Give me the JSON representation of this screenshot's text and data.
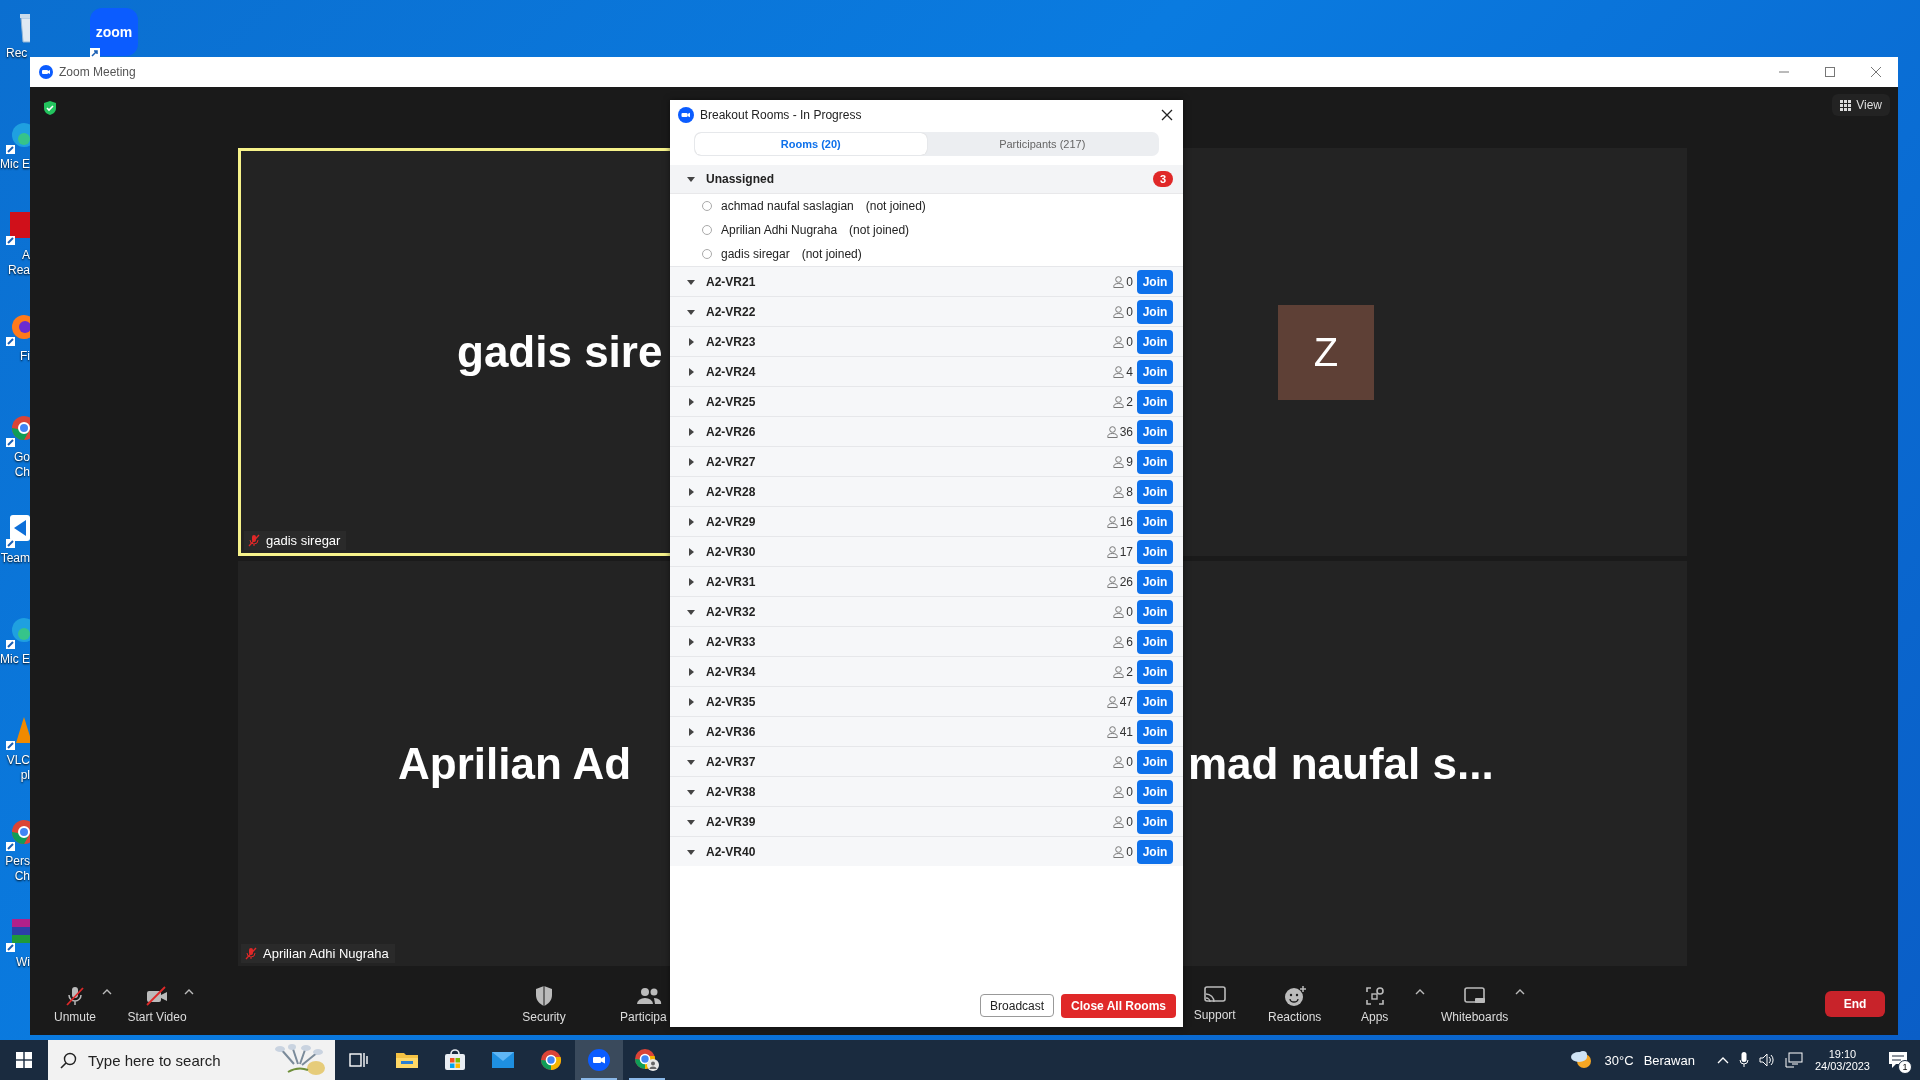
{
  "desktop": {
    "icons": [
      {
        "kind": "recycle",
        "label": "Rec"
      },
      {
        "kind": "edge",
        "label": "Mic E"
      },
      {
        "kind": "pdf",
        "label": "A Rea"
      },
      {
        "kind": "firefox",
        "label": "Fi"
      },
      {
        "kind": "chrome",
        "label": "Go Ch"
      },
      {
        "kind": "teamviewer",
        "label": "Team"
      },
      {
        "kind": "edge",
        "label": "Mic E"
      },
      {
        "kind": "vlc",
        "label": "VLC pl"
      },
      {
        "kind": "chrome",
        "label": "Pers Ch"
      },
      {
        "kind": "winrar",
        "label": "Wi"
      }
    ],
    "zoom_shortcut": {
      "label": "zoom"
    }
  },
  "window": {
    "title": "Zoom Meeting",
    "view_button": "View"
  },
  "videos": [
    {
      "kind": "name",
      "big_name": "gadis sire",
      "name_tag": "gadis siregar",
      "muted": true,
      "speaking": true
    },
    {
      "kind": "avatar",
      "avatar": "Z",
      "speaking": false
    },
    {
      "kind": "name",
      "big_name": "Aprilian Ad",
      "name_tag": "Aprilian Adhi Nugraha",
      "muted": true,
      "speaking": false
    },
    {
      "kind": "name",
      "big_name": "mad naufal s...",
      "speaking": false
    }
  ],
  "dialog": {
    "title": "Breakout Rooms - In Progress",
    "tabs": [
      {
        "label": "Rooms (20)",
        "selected": true
      },
      {
        "label": "Participants (217)",
        "selected": false
      }
    ],
    "unassigned": {
      "label": "Unassigned",
      "expanded": true,
      "count": "3",
      "participants": [
        {
          "name": "achmad naufal saslagian",
          "status": "(not joined)",
          "selected": false
        },
        {
          "name": "Aprilian Adhi Nugraha",
          "status": "(not joined)",
          "selected": false
        },
        {
          "name": "gadis siregar",
          "status": "(not joined)",
          "selected": false
        }
      ]
    },
    "rooms": [
      {
        "name": "A2-VR21",
        "expanded": true,
        "count": "0",
        "button": "Join"
      },
      {
        "name": "A2-VR22",
        "expanded": true,
        "count": "0",
        "button": "Join"
      },
      {
        "name": "A2-VR23",
        "expanded": false,
        "count": "0",
        "button": "Join"
      },
      {
        "name": "A2-VR24",
        "expanded": false,
        "count": "4",
        "button": "Join"
      },
      {
        "name": "A2-VR25",
        "expanded": false,
        "count": "2",
        "button": "Join"
      },
      {
        "name": "A2-VR26",
        "expanded": false,
        "count": "36",
        "button": "Join"
      },
      {
        "name": "A2-VR27",
        "expanded": false,
        "count": "9",
        "button": "Join"
      },
      {
        "name": "A2-VR28",
        "expanded": false,
        "count": "8",
        "button": "Join"
      },
      {
        "name": "A2-VR29",
        "expanded": false,
        "count": "16",
        "button": "Join"
      },
      {
        "name": "A2-VR30",
        "expanded": false,
        "count": "17",
        "button": "Join"
      },
      {
        "name": "A2-VR31",
        "expanded": false,
        "count": "26",
        "button": "Join"
      },
      {
        "name": "A2-VR32",
        "expanded": true,
        "count": "0",
        "button": "Join"
      },
      {
        "name": "A2-VR33",
        "expanded": false,
        "count": "6",
        "button": "Join"
      },
      {
        "name": "A2-VR34",
        "expanded": false,
        "count": "2",
        "button": "Join"
      },
      {
        "name": "A2-VR35",
        "expanded": false,
        "count": "47",
        "button": "Join"
      },
      {
        "name": "A2-VR36",
        "expanded": false,
        "count": "41",
        "button": "Join"
      },
      {
        "name": "A2-VR37",
        "expanded": true,
        "count": "0",
        "button": "Join"
      },
      {
        "name": "A2-VR38",
        "expanded": true,
        "count": "0",
        "button": "Join"
      },
      {
        "name": "A2-VR39",
        "expanded": true,
        "count": "0",
        "button": "Join"
      },
      {
        "name": "A2-VR40",
        "expanded": true,
        "count": "0",
        "button": "Join"
      }
    ],
    "buttons": [
      {
        "label": "Broadcast",
        "kind": "secondary"
      },
      {
        "label": "Close All Rooms",
        "kind": "danger"
      }
    ]
  },
  "toolbar": {
    "left": [
      {
        "kind": "mic-off",
        "label": "Unmute",
        "caret": true
      },
      {
        "kind": "video-off",
        "label": "Start Video",
        "caret": true
      }
    ],
    "middle": [
      {
        "kind": "shield",
        "label": "Security",
        "caret": false
      },
      {
        "kind": "people",
        "label": "Participa",
        "caret": false
      }
    ],
    "right": [
      {
        "kind": "cast",
        "label": "Support",
        "caret": false
      },
      {
        "kind": "smile",
        "label": "Reactions",
        "caret": false
      },
      {
        "kind": "apps",
        "label": "Apps",
        "caret": true
      },
      {
        "kind": "whiteboard",
        "label": "Whiteboards",
        "caret": true
      }
    ],
    "end": "End"
  },
  "taskbar": {
    "search": {
      "placeholder": "Type here to search"
    },
    "apps": [
      {
        "kind": "taskview",
        "selected": false,
        "running": false
      },
      {
        "kind": "folder",
        "selected": false,
        "running": false
      },
      {
        "kind": "store",
        "selected": false,
        "running": false
      },
      {
        "kind": "mail",
        "selected": false,
        "running": false
      },
      {
        "kind": "chrome",
        "selected": false,
        "running": false
      },
      {
        "kind": "zoom",
        "selected": true,
        "running": true
      },
      {
        "kind": "chrome-profile",
        "selected": false,
        "running": true
      }
    ],
    "weather": {
      "temperature": "30°C",
      "condition": "Berawan"
    },
    "time": "19:10",
    "date": "24/03/2023",
    "notifications": "1"
  }
}
